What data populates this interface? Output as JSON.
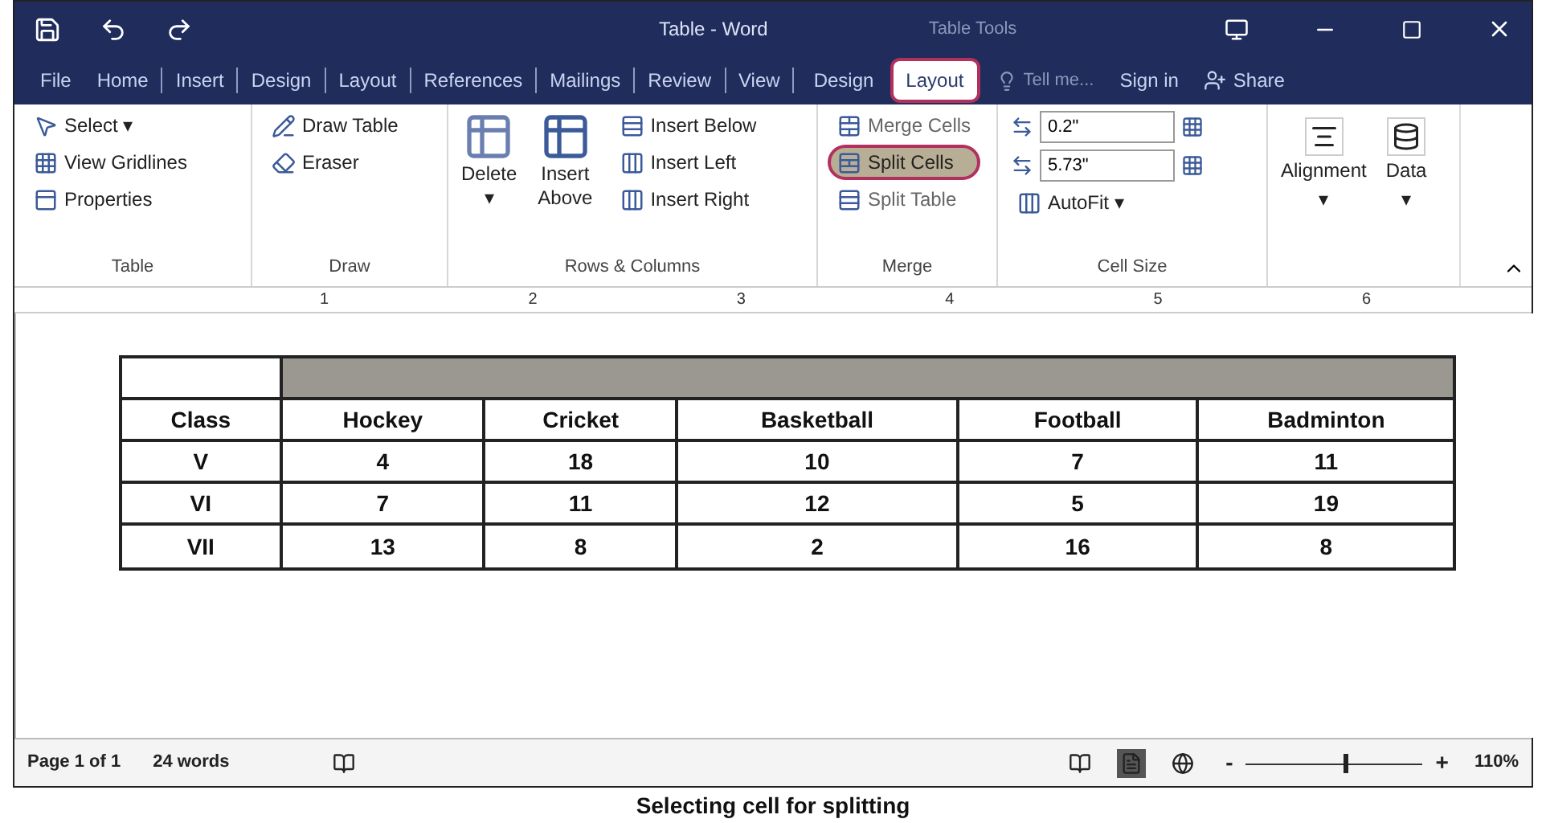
{
  "window": {
    "title": "Table - Word",
    "context_title": "Table Tools"
  },
  "tabs": [
    {
      "label": "File",
      "selected": false,
      "circled": false
    },
    {
      "label": "Home",
      "selected": false,
      "circled": false
    },
    {
      "label": "Insert",
      "selected": false,
      "circled": false
    },
    {
      "label": "Design",
      "selected": false,
      "circled": false
    },
    {
      "label": "Layout",
      "selected": false,
      "circled": false
    },
    {
      "label": "References",
      "selected": false,
      "circled": false
    },
    {
      "label": "Mailings",
      "selected": false,
      "circled": false
    },
    {
      "label": "Review",
      "selected": false,
      "circled": false
    },
    {
      "label": "View",
      "selected": false,
      "circled": false
    }
  ],
  "context_tabs": [
    {
      "label": "Design",
      "selected": false,
      "circled": false
    },
    {
      "label": "Layout",
      "selected": true,
      "circled": true
    }
  ],
  "tell_me": "Tell me...",
  "sign_in": "Sign in",
  "share": "Share",
  "ribbon": {
    "table": {
      "label": "Table",
      "items": [
        "Select ▾",
        "View Gridlines",
        "Properties"
      ]
    },
    "draw": {
      "label": "Draw",
      "items": [
        "Draw Table",
        "Eraser"
      ]
    },
    "rows_columns": {
      "label": "Rows & Columns",
      "delete": "Delete",
      "delete_caret": "▾",
      "insert_above": "Insert Above",
      "items": [
        "Insert Below",
        "Insert Left",
        "Insert Right"
      ]
    },
    "merge": {
      "label": "Merge",
      "items": [
        {
          "label": "Merge Cells",
          "selected": false,
          "circled": false
        },
        {
          "label": "Split Cells",
          "selected": true,
          "circled": true
        },
        {
          "label": "Split Table",
          "selected": false,
          "circled": false
        }
      ]
    },
    "cell_size": {
      "label": "Cell Size",
      "height": "0.2\"",
      "width": "5.73\"",
      "autofit": "AutoFit ▾"
    },
    "alignment": {
      "label": "Alignment",
      "caret": "▾"
    },
    "data": {
      "label": "Data",
      "caret": "▾"
    }
  },
  "ruler": [
    "1",
    "2",
    "3",
    "4",
    "5",
    "6"
  ],
  "table": {
    "merged_row_selected": true,
    "columns": [
      "Class",
      "Hockey",
      "Cricket",
      "Basketball",
      "Football",
      "Badminton"
    ],
    "rows": [
      [
        "V",
        "4",
        "18",
        "10",
        "7",
        "11"
      ],
      [
        "VI",
        "7",
        "11",
        "12",
        "5",
        "19"
      ],
      [
        "VII",
        "13",
        "8",
        "2",
        "16",
        "8"
      ]
    ]
  },
  "status_bar": {
    "page": "Page 1 of 1",
    "words": "24 words",
    "zoom": "110%",
    "zoom_minus": "-",
    "zoom_plus": "+",
    "level": 0.55
  },
  "caption": "Selecting cell for splitting"
}
